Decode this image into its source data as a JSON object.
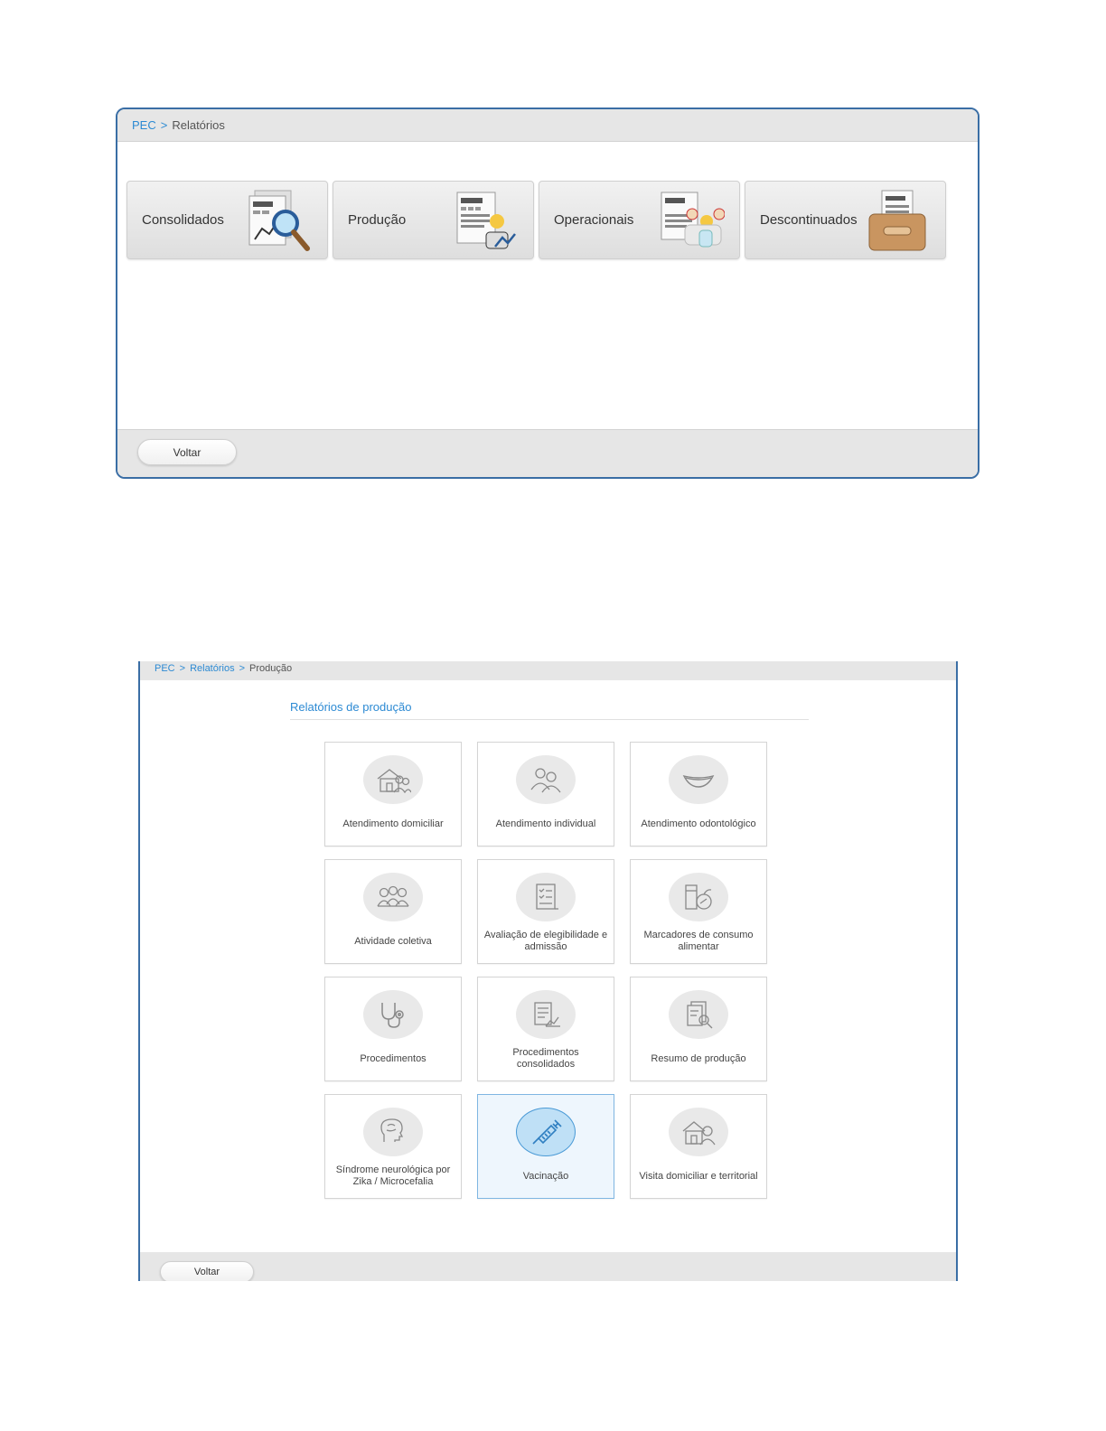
{
  "screen1": {
    "breadcrumb": {
      "root": "PEC",
      "separator": ">",
      "current": "Relatórios"
    },
    "tiles": [
      {
        "label": "Consolidados",
        "icon": "report-magnifier-icon"
      },
      {
        "label": "Produção",
        "icon": "report-production-icon"
      },
      {
        "label": "Operacionais",
        "icon": "report-professionals-icon"
      },
      {
        "label": "Descontinuados",
        "icon": "archive-box-icon"
      }
    ],
    "back_button": "Voltar"
  },
  "screen2": {
    "breadcrumb": {
      "root": "PEC",
      "separator": ">",
      "middle": "Relatórios",
      "current": "Produção"
    },
    "section_title": "Relatórios de produção",
    "tiles": [
      {
        "label": "Atendimento domiciliar",
        "icon": "house-people-icon"
      },
      {
        "label": "Atendimento individual",
        "icon": "people-icon"
      },
      {
        "label": "Atendimento odontológico",
        "icon": "mouth-icon"
      },
      {
        "label": "Atividade coletiva",
        "icon": "group-icon"
      },
      {
        "label": "Avaliação de elegibilidade e admissão",
        "icon": "checklist-icon"
      },
      {
        "label": "Marcadores de consumo alimentar",
        "icon": "food-icon"
      },
      {
        "label": "Procedimentos",
        "icon": "stethoscope-icon"
      },
      {
        "label": "Procedimentos consolidados",
        "icon": "document-chart-icon"
      },
      {
        "label": "Resumo de produção",
        "icon": "documents-search-icon"
      },
      {
        "label": "Síndrome neurológica por Zika / Microcefalia",
        "icon": "head-icon"
      },
      {
        "label": "Vacinação",
        "icon": "syringe-icon",
        "selected": true
      },
      {
        "label": "Visita domiciliar e territorial",
        "icon": "house-person-icon"
      }
    ],
    "back_button": "Voltar"
  }
}
